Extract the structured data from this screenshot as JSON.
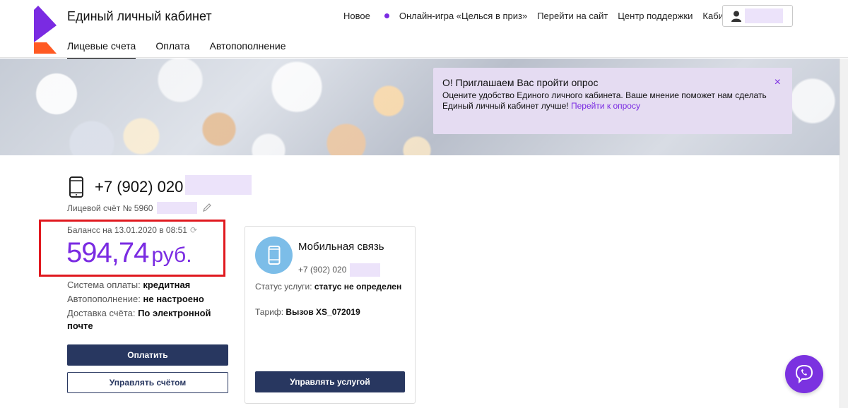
{
  "header": {
    "title": "Единый личный кабинет",
    "nav": {
      "new": "Новое",
      "game": "Онлайн-игра «Целься в приз»",
      "site": "Перейти на сайт",
      "support": "Центр поддержки",
      "cabinets": "Кабинеты"
    },
    "tabs": [
      "Лицевые счета",
      "Оплата",
      "Автопополнение"
    ]
  },
  "survey": {
    "title": "О! Приглашаем Вас пройти опрос",
    "text": "Оцените удобство Единого личного кабинета. Ваше мнение поможет нам сделать Единый личный кабинет лучше!",
    "link": "Перейти к опросу",
    "close": "×"
  },
  "account": {
    "phone": "+7 (902) 020",
    "account_number": "Лицевой счёт № 5960",
    "balance_label": "Балансс на 13.01.2020 в 08:51",
    "balance_value": "594,74",
    "balance_currency": "руб.",
    "payment_system_label": "Система оплаты:",
    "payment_system_value": "кредитная",
    "autopay_label": "Автопополнение:",
    "autopay_value": "не настроено",
    "delivery_label": "Доставка счёта:",
    "delivery_value": "По электронной почте",
    "pay_button": "Оплатить",
    "manage_button": "Управлять счётом"
  },
  "service": {
    "title": "Мобильная связь",
    "phone": "+7 (902) 020",
    "status_label": "Статус услуги:",
    "status_value": "статус не определен",
    "tariff_label": "Тариф:",
    "tariff_value": "Вызов XS_072019",
    "manage_button": "Управлять услугой"
  },
  "colors": {
    "accent": "#7a2be2",
    "button": "#283760",
    "highlight": "#e0191f",
    "survey_bg": "#e5dcf2"
  }
}
